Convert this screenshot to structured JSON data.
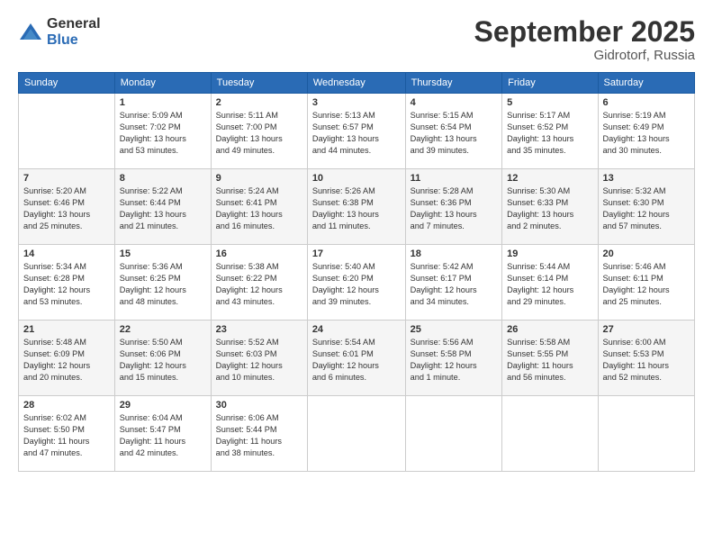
{
  "logo": {
    "general": "General",
    "blue": "Blue"
  },
  "header": {
    "month": "September 2025",
    "location": "Gidrotorf, Russia"
  },
  "weekdays": [
    "Sunday",
    "Monday",
    "Tuesday",
    "Wednesday",
    "Thursday",
    "Friday",
    "Saturday"
  ],
  "weeks": [
    [
      {
        "day": "",
        "info": ""
      },
      {
        "day": "1",
        "info": "Sunrise: 5:09 AM\nSunset: 7:02 PM\nDaylight: 13 hours\nand 53 minutes."
      },
      {
        "day": "2",
        "info": "Sunrise: 5:11 AM\nSunset: 7:00 PM\nDaylight: 13 hours\nand 49 minutes."
      },
      {
        "day": "3",
        "info": "Sunrise: 5:13 AM\nSunset: 6:57 PM\nDaylight: 13 hours\nand 44 minutes."
      },
      {
        "day": "4",
        "info": "Sunrise: 5:15 AM\nSunset: 6:54 PM\nDaylight: 13 hours\nand 39 minutes."
      },
      {
        "day": "5",
        "info": "Sunrise: 5:17 AM\nSunset: 6:52 PM\nDaylight: 13 hours\nand 35 minutes."
      },
      {
        "day": "6",
        "info": "Sunrise: 5:19 AM\nSunset: 6:49 PM\nDaylight: 13 hours\nand 30 minutes."
      }
    ],
    [
      {
        "day": "7",
        "info": "Sunrise: 5:20 AM\nSunset: 6:46 PM\nDaylight: 13 hours\nand 25 minutes."
      },
      {
        "day": "8",
        "info": "Sunrise: 5:22 AM\nSunset: 6:44 PM\nDaylight: 13 hours\nand 21 minutes."
      },
      {
        "day": "9",
        "info": "Sunrise: 5:24 AM\nSunset: 6:41 PM\nDaylight: 13 hours\nand 16 minutes."
      },
      {
        "day": "10",
        "info": "Sunrise: 5:26 AM\nSunset: 6:38 PM\nDaylight: 13 hours\nand 11 minutes."
      },
      {
        "day": "11",
        "info": "Sunrise: 5:28 AM\nSunset: 6:36 PM\nDaylight: 13 hours\nand 7 minutes."
      },
      {
        "day": "12",
        "info": "Sunrise: 5:30 AM\nSunset: 6:33 PM\nDaylight: 13 hours\nand 2 minutes."
      },
      {
        "day": "13",
        "info": "Sunrise: 5:32 AM\nSunset: 6:30 PM\nDaylight: 12 hours\nand 57 minutes."
      }
    ],
    [
      {
        "day": "14",
        "info": "Sunrise: 5:34 AM\nSunset: 6:28 PM\nDaylight: 12 hours\nand 53 minutes."
      },
      {
        "day": "15",
        "info": "Sunrise: 5:36 AM\nSunset: 6:25 PM\nDaylight: 12 hours\nand 48 minutes."
      },
      {
        "day": "16",
        "info": "Sunrise: 5:38 AM\nSunset: 6:22 PM\nDaylight: 12 hours\nand 43 minutes."
      },
      {
        "day": "17",
        "info": "Sunrise: 5:40 AM\nSunset: 6:20 PM\nDaylight: 12 hours\nand 39 minutes."
      },
      {
        "day": "18",
        "info": "Sunrise: 5:42 AM\nSunset: 6:17 PM\nDaylight: 12 hours\nand 34 minutes."
      },
      {
        "day": "19",
        "info": "Sunrise: 5:44 AM\nSunset: 6:14 PM\nDaylight: 12 hours\nand 29 minutes."
      },
      {
        "day": "20",
        "info": "Sunrise: 5:46 AM\nSunset: 6:11 PM\nDaylight: 12 hours\nand 25 minutes."
      }
    ],
    [
      {
        "day": "21",
        "info": "Sunrise: 5:48 AM\nSunset: 6:09 PM\nDaylight: 12 hours\nand 20 minutes."
      },
      {
        "day": "22",
        "info": "Sunrise: 5:50 AM\nSunset: 6:06 PM\nDaylight: 12 hours\nand 15 minutes."
      },
      {
        "day": "23",
        "info": "Sunrise: 5:52 AM\nSunset: 6:03 PM\nDaylight: 12 hours\nand 10 minutes."
      },
      {
        "day": "24",
        "info": "Sunrise: 5:54 AM\nSunset: 6:01 PM\nDaylight: 12 hours\nand 6 minutes."
      },
      {
        "day": "25",
        "info": "Sunrise: 5:56 AM\nSunset: 5:58 PM\nDaylight: 12 hours\nand 1 minute."
      },
      {
        "day": "26",
        "info": "Sunrise: 5:58 AM\nSunset: 5:55 PM\nDaylight: 11 hours\nand 56 minutes."
      },
      {
        "day": "27",
        "info": "Sunrise: 6:00 AM\nSunset: 5:53 PM\nDaylight: 11 hours\nand 52 minutes."
      }
    ],
    [
      {
        "day": "28",
        "info": "Sunrise: 6:02 AM\nSunset: 5:50 PM\nDaylight: 11 hours\nand 47 minutes."
      },
      {
        "day": "29",
        "info": "Sunrise: 6:04 AM\nSunset: 5:47 PM\nDaylight: 11 hours\nand 42 minutes."
      },
      {
        "day": "30",
        "info": "Sunrise: 6:06 AM\nSunset: 5:44 PM\nDaylight: 11 hours\nand 38 minutes."
      },
      {
        "day": "",
        "info": ""
      },
      {
        "day": "",
        "info": ""
      },
      {
        "day": "",
        "info": ""
      },
      {
        "day": "",
        "info": ""
      }
    ]
  ]
}
